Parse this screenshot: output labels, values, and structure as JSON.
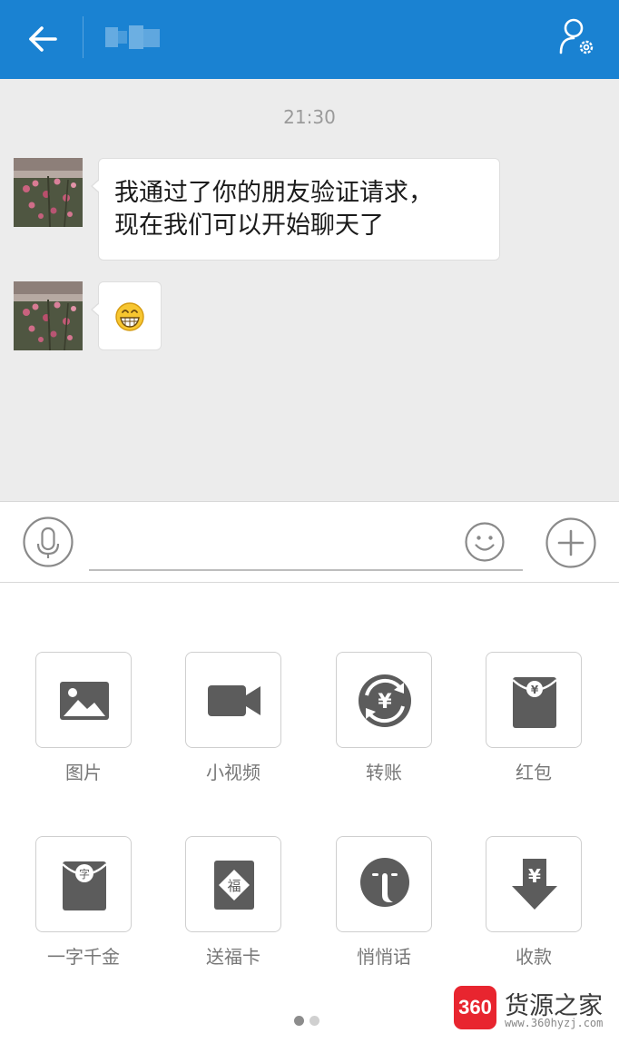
{
  "header": {
    "back_icon": "arrow-left-icon",
    "contact_name_blurred": true,
    "profile_icon": "person-settings-icon",
    "background_color": "#1a82d2"
  },
  "chat": {
    "timestamp": "21:30",
    "messages": [
      {
        "sender": "contact",
        "type": "text",
        "lines": [
          "我通过了你的朋友验证请求，",
          "现在我们可以开始聊天了"
        ]
      },
      {
        "sender": "contact",
        "type": "emoji",
        "icon": "grinning-face-icon"
      }
    ]
  },
  "input_bar": {
    "voice_icon": "microphone-icon",
    "emoji_icon": "smiley-icon",
    "more_icon": "plus-icon",
    "text_value": ""
  },
  "panel": {
    "items": [
      {
        "label": "图片",
        "icon": "image-icon"
      },
      {
        "label": "小视频",
        "icon": "video-camera-icon"
      },
      {
        "label": "转账",
        "icon": "transfer-icon"
      },
      {
        "label": "红包",
        "icon": "red-packet-icon"
      },
      {
        "label": "一字千金",
        "icon": "word-packet-icon"
      },
      {
        "label": "送福卡",
        "icon": "fortune-card-icon"
      },
      {
        "label": "悄悄话",
        "icon": "whisper-icon"
      },
      {
        "label": "收款",
        "icon": "receive-money-icon"
      }
    ],
    "page_count": 2,
    "current_page": 1
  },
  "watermark": {
    "logo_text": "360",
    "title": "货源之家",
    "url": "www.360hyzj.com"
  }
}
